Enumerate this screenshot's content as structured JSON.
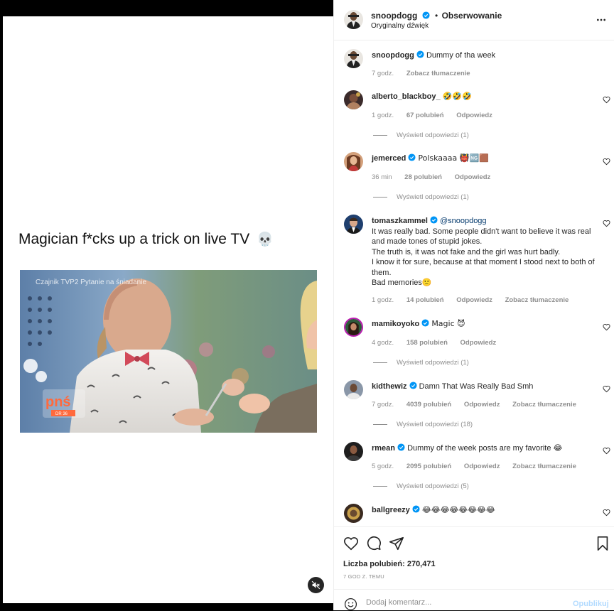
{
  "header": {
    "username": "snoopdogg",
    "separator": "•",
    "follow_label": "Obserwowanie",
    "audio": "Oryginalny dźwięk"
  },
  "media": {
    "caption": "Magician f*cks up a trick on live TV",
    "caption_emoji": "💀",
    "video_overlay_text": "Czajnik TVP2 Pytanie na śniadanie",
    "video_logo": "pnś",
    "video_logo_sub": "DR 36"
  },
  "caption_comment": {
    "username": "snoopdogg",
    "text": "Dummy of tha week",
    "time": "7 godz.",
    "translate": "Zobacz tłumaczenie"
  },
  "comments": [
    {
      "username": "alberto_blackboy_",
      "verified": false,
      "text": "🤣🤣🤣",
      "time": "1 godz.",
      "likes": "67 polubień",
      "reply": "Odpowiedz",
      "translate": "",
      "replies": "Wyświetl odpowiedzi (1)"
    },
    {
      "username": "jemerced",
      "verified": true,
      "text": "Polskaaaa 👹🆖🟫",
      "time": "36 min",
      "likes": "28 polubień",
      "reply": "Odpowiedz",
      "translate": "",
      "replies": "Wyświetl odpowiedzi (1)"
    },
    {
      "username": "tomaszkammel",
      "verified": true,
      "mention": "@snoopdogg",
      "text": "It was really bad. Some people didn't want to believe it was real and made tones of stupid jokes.\nThe truth is, it was not fake and the girl was hurt badly.\nI know it for sure, because at that moment I stood next to both of them.\nBad memories🙁",
      "time": "1 godz.",
      "likes": "14 polubień",
      "reply": "Odpowiedz",
      "translate": "Zobacz tłumaczenie",
      "replies": ""
    },
    {
      "username": "mamikoyoko",
      "verified": true,
      "text": "Magic 😈",
      "time": "4 godz.",
      "likes": "158 polubień",
      "reply": "Odpowiedz",
      "translate": "",
      "replies": "Wyświetl odpowiedzi (1)"
    },
    {
      "username": "kidthewiz",
      "verified": true,
      "text": "Damn That Was Really Bad Smh",
      "time": "7 godz.",
      "likes": "4039 polubień",
      "reply": "Odpowiedz",
      "translate": "Zobacz tłumaczenie",
      "replies": "Wyświetl odpowiedzi (18)"
    },
    {
      "username": "rmean",
      "verified": true,
      "text": "Dummy of the week posts are my favorite 😂",
      "time": "5 godz.",
      "likes": "2095 polubień",
      "reply": "Odpowiedz",
      "translate": "Zobacz tłumaczenie",
      "replies": "Wyświetl odpowiedzi (5)"
    },
    {
      "username": "ballgreezy",
      "verified": true,
      "text": "😂😂😂😂😂😂😂😂",
      "time": "",
      "likes": "",
      "reply": "",
      "translate": "",
      "replies": ""
    }
  ],
  "actions": {
    "likes": "Liczba polubień: 270,471",
    "posted": "7 GOD Z. TEMU"
  },
  "add_comment": {
    "placeholder": "Dodaj komentarz...",
    "publish": "Opublikuj"
  },
  "colors": {
    "verified": "#0095f6",
    "link": "#00376b",
    "publish_disabled": "#b3dbff",
    "secondary_text": "#8e8e8e"
  }
}
